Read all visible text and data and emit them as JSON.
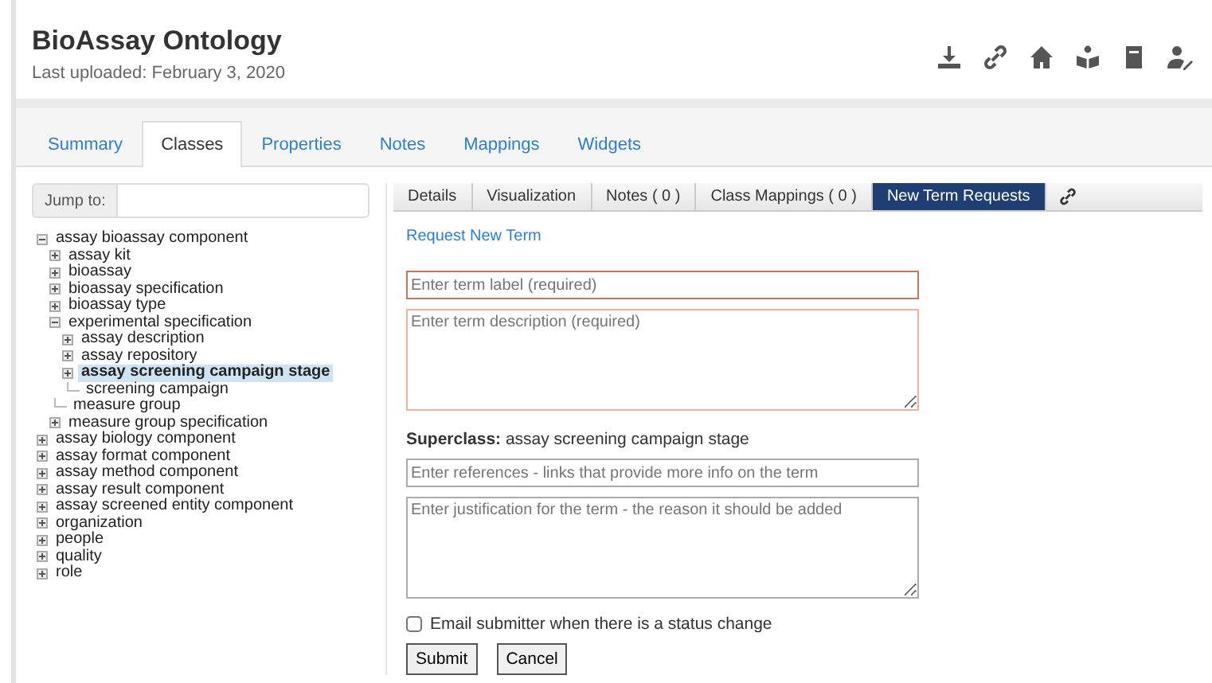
{
  "header": {
    "title": "BioAssay Ontology",
    "subtitle": "Last uploaded: February 3, 2020"
  },
  "tabs": [
    {
      "label": "Summary",
      "selected": false
    },
    {
      "label": "Classes",
      "selected": true
    },
    {
      "label": "Properties",
      "selected": false
    },
    {
      "label": "Notes",
      "selected": false
    },
    {
      "label": "Mappings",
      "selected": false
    },
    {
      "label": "Widgets",
      "selected": false
    }
  ],
  "jump_to": {
    "label": "Jump to:"
  },
  "tree": [
    {
      "label": "assay bioassay component",
      "kind": "branch",
      "expanded": true,
      "selected": false,
      "children": [
        {
          "label": "assay kit",
          "kind": "branch",
          "expanded": false,
          "selected": false
        },
        {
          "label": "bioassay",
          "kind": "branch",
          "expanded": false,
          "selected": false
        },
        {
          "label": "bioassay specification",
          "kind": "branch",
          "expanded": false,
          "selected": false
        },
        {
          "label": "bioassay type",
          "kind": "branch",
          "expanded": false,
          "selected": false
        },
        {
          "label": "experimental specification",
          "kind": "branch",
          "expanded": true,
          "selected": false,
          "children": [
            {
              "label": "assay description",
              "kind": "branch",
              "expanded": false,
              "selected": false
            },
            {
              "label": "assay repository",
              "kind": "branch",
              "expanded": false,
              "selected": false
            },
            {
              "label": "assay screening campaign stage",
              "kind": "branch",
              "expanded": false,
              "selected": true
            },
            {
              "label": "screening campaign",
              "kind": "leaf",
              "selected": false
            }
          ]
        },
        {
          "label": "measure group",
          "kind": "leaf",
          "selected": false
        },
        {
          "label": "measure group specification",
          "kind": "branch",
          "expanded": false,
          "selected": false
        }
      ]
    },
    {
      "label": "assay biology component",
      "kind": "branch",
      "expanded": false,
      "selected": false
    },
    {
      "label": "assay format component",
      "kind": "branch",
      "expanded": false,
      "selected": false
    },
    {
      "label": "assay method component",
      "kind": "branch",
      "expanded": false,
      "selected": false
    },
    {
      "label": "assay result component",
      "kind": "branch",
      "expanded": false,
      "selected": false
    },
    {
      "label": "assay screened entity component",
      "kind": "branch",
      "expanded": false,
      "selected": false
    },
    {
      "label": "organization",
      "kind": "branch",
      "expanded": false,
      "selected": false
    },
    {
      "label": "people",
      "kind": "branch",
      "expanded": false,
      "selected": false
    },
    {
      "label": "quality",
      "kind": "branch",
      "expanded": false,
      "selected": false
    },
    {
      "label": "role",
      "kind": "branch",
      "expanded": false,
      "selected": false
    }
  ],
  "detail_tabs": [
    {
      "label": "Details",
      "selected": false
    },
    {
      "label": "Visualization",
      "selected": false
    },
    {
      "label": "Notes ( 0 )",
      "selected": false
    },
    {
      "label": "Class Mappings ( 0 )",
      "selected": false
    },
    {
      "label": "New Term Requests",
      "selected": true
    }
  ],
  "form": {
    "link": "Request New Term",
    "term_label": {
      "placeholder": "Enter term label (required)"
    },
    "term_description": {
      "placeholder": "Enter term description (required)"
    },
    "superclass": {
      "label": "Superclass:",
      "value": "assay screening campaign stage"
    },
    "references": {
      "placeholder": "Enter references - links that provide more info on the term"
    },
    "justification": {
      "placeholder": "Enter justification for the term - the reason it should be added"
    },
    "email_checkbox": {
      "label": "Email submitter when there is a status change",
      "checked": false
    },
    "buttons": [
      "Submit",
      "Cancel"
    ]
  }
}
